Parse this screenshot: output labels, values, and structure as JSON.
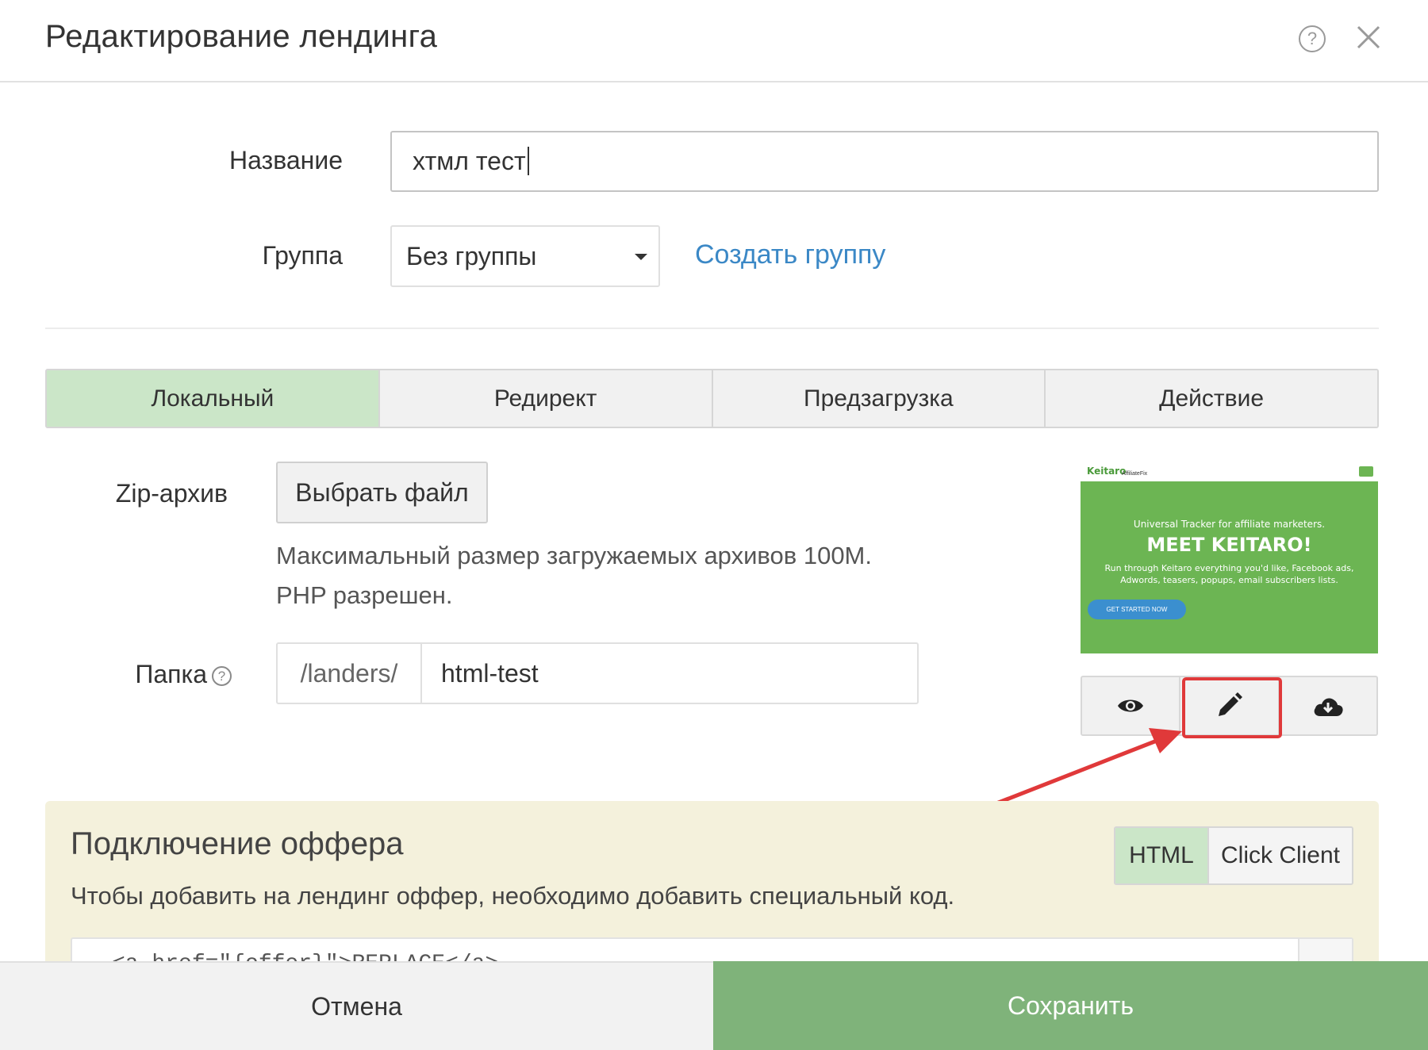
{
  "dialog": {
    "title": "Редактирование лендинга"
  },
  "form": {
    "name_label": "Название",
    "name_value": "хтмл тест",
    "group_label": "Группа",
    "group_value": "Без группы",
    "create_group_link": "Создать группу"
  },
  "tabs": [
    {
      "label": "Локальный",
      "active": true
    },
    {
      "label": "Редирект",
      "active": false
    },
    {
      "label": "Предзагрузка",
      "active": false
    },
    {
      "label": "Действие",
      "active": false
    }
  ],
  "upload": {
    "zip_label": "Zip-архив",
    "choose_file_button": "Выбрать файл",
    "hint_line1": "Максимальный размер загружаемых архивов 100M.",
    "hint_line2": "PHP разрешен.",
    "folder_label": "Папка",
    "folder_prefix": "/landers/",
    "folder_value": "html-test"
  },
  "preview": {
    "brand": "Keitaro",
    "brand_sub": "AffiliateFix",
    "tagline": "Universal Tracker for affiliate marketers.",
    "headline": "MEET KEITARO!",
    "body": "Run through Keitaro everything you'd like, Facebook ads, Adwords, teasers, popups, email subscribers lists.",
    "cta": "GET STARTED NOW",
    "actions": [
      "eye-icon",
      "pencil-icon",
      "cloud-download-icon"
    ]
  },
  "offer": {
    "title": "Подключение оффера",
    "description": "Чтобы добавить на лендинг оффер, необходимо добавить специальный код.",
    "mode_html": "HTML",
    "mode_click_client": "Click Client",
    "code": "<a href=\"{offer}\">REPLACE</a>"
  },
  "footer": {
    "cancel": "Отмена",
    "save": "Сохранить"
  },
  "colors": {
    "accent_green": "#7fb37a",
    "active_tab": "#cbe6c8",
    "link_blue": "#3b88c6",
    "annotation_red": "#e0393a",
    "offer_panel": "#f4f1dc"
  }
}
